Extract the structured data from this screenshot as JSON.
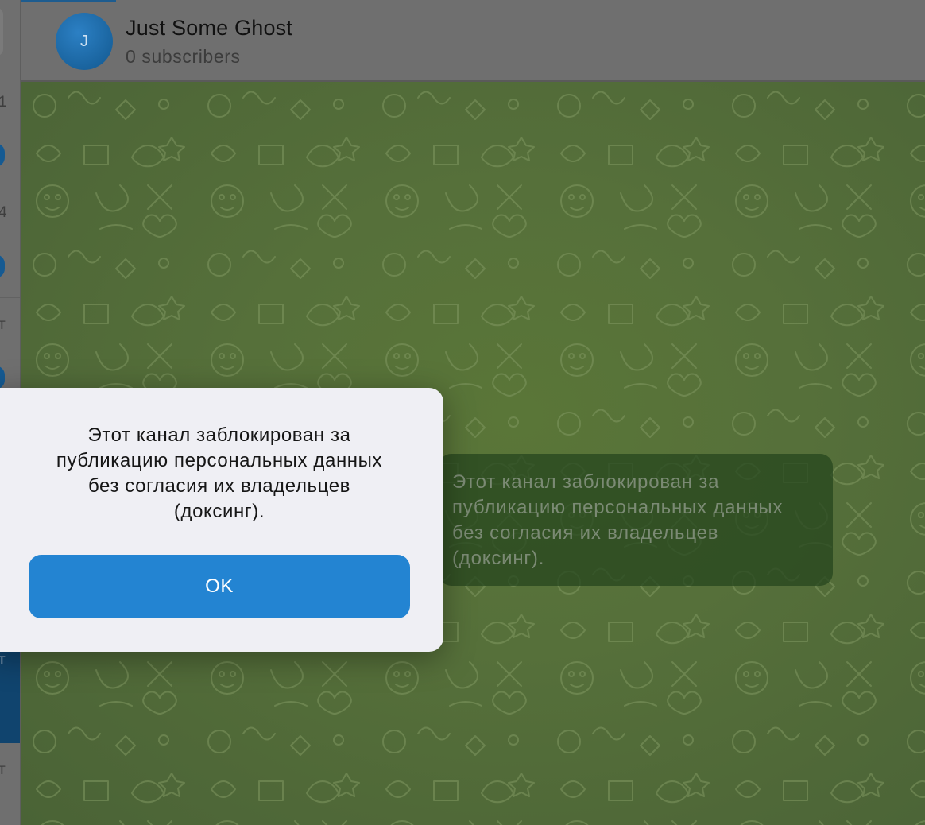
{
  "sidebar": {
    "partial_times": [
      "1",
      "4",
      "т",
      "т",
      "т"
    ]
  },
  "header": {
    "avatar_letter": "J",
    "title": "Just Some Ghost",
    "subtitle": "0 subscribers"
  },
  "chat": {
    "service_message": "Этот канал заблокирован за\nпубликацию персональных данных\nбез согласия их владельцев\n(доксинг)."
  },
  "dialog": {
    "message": "Этот канал заблокирован за\nпубликацию персональных данных\nбез согласия их владельцев\n(доксинг).",
    "ok_label": "OK"
  },
  "colors": {
    "accent": "#2384d2",
    "avatar": "#1a6aa8",
    "chat_background": "#56703a",
    "dialog_background": "#efeff4"
  }
}
